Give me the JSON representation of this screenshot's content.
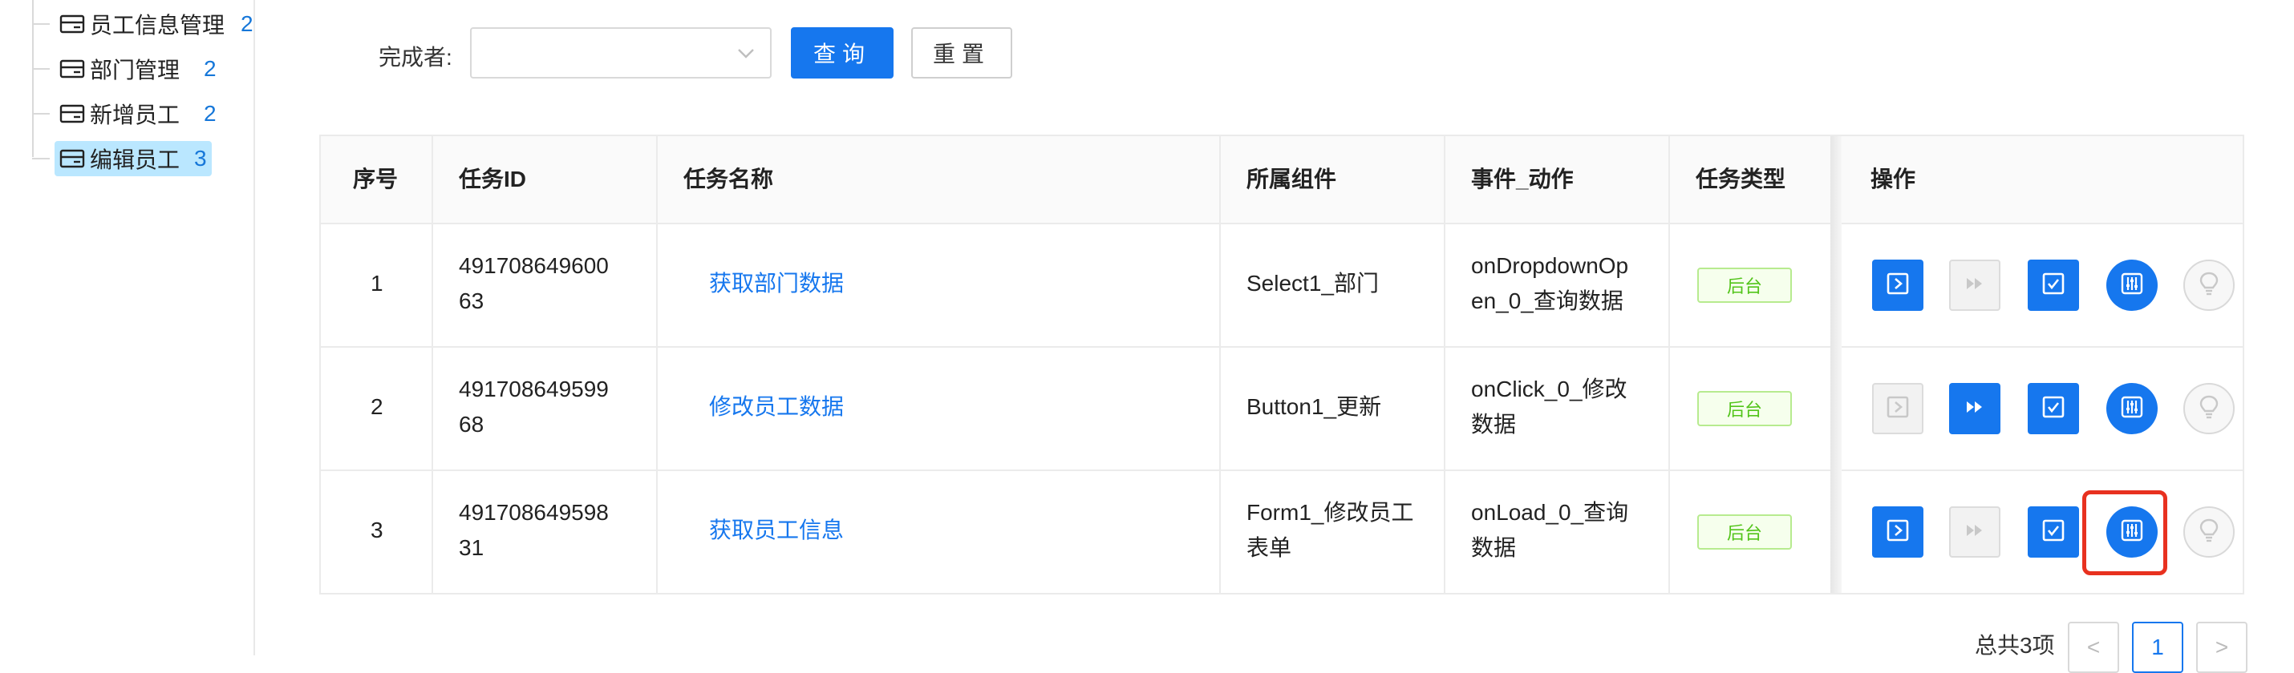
{
  "sidebar": {
    "items": [
      {
        "label": "员工信息管理",
        "count": "2",
        "selected": false
      },
      {
        "label": "部门管理",
        "count": "2",
        "selected": false
      },
      {
        "label": "新增员工",
        "count": "2",
        "selected": false
      },
      {
        "label": "编辑员工",
        "count": "3",
        "selected": true
      }
    ]
  },
  "filter": {
    "label": "完成者:",
    "select_value": "",
    "query_button": "查询",
    "reset_button": "重置"
  },
  "table": {
    "headers": [
      "序号",
      "任务ID",
      "任务名称",
      "所属组件",
      "事件_动作",
      "任务类型",
      "操作"
    ],
    "rows": [
      {
        "index": "1",
        "task_id_line1": "491708649600",
        "task_id_line2": "63",
        "name": "获取部门数据",
        "component_line1": "Select1_部门",
        "component_line2": "",
        "event_line1": "onDropdownOp",
        "event_line2": "en_0_查询数据",
        "type": "后台"
      },
      {
        "index": "2",
        "task_id_line1": "491708649599",
        "task_id_line2": "68",
        "name": "修改员工数据",
        "component_line1": "Button1_更新",
        "component_line2": "",
        "event_line1": "onClick_0_修改",
        "event_line2": "数据",
        "type": "后台"
      },
      {
        "index": "3",
        "task_id_line1": "491708649598",
        "task_id_line2": "31",
        "name": "获取员工信息",
        "component_line1": "Form1_修改员工",
        "component_line2": "表单",
        "event_line1": "onLoad_0_查询",
        "event_line2": "数据",
        "type": "后台"
      }
    ],
    "action_icons": [
      "run-icon",
      "fast-forward-icon",
      "checkbox-icon",
      "settings-sliders-icon",
      "lightbulb-icon"
    ]
  },
  "pagination": {
    "total": "总共3项",
    "current_page": "1",
    "prev": "<",
    "next": ">"
  },
  "colors": {
    "primary": "#1677ee",
    "tag_green": "#52c41a",
    "highlight_red": "#e8311f",
    "selected_bg": "#bae7ff"
  }
}
